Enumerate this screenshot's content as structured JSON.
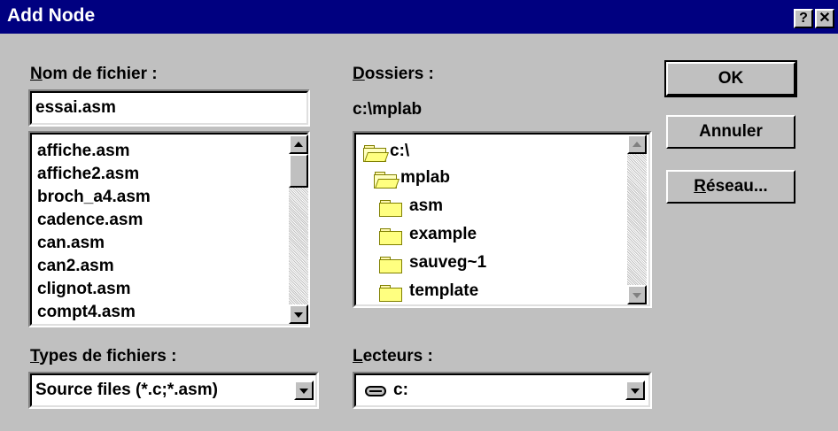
{
  "window": {
    "title": "Add Node",
    "help_btn": "?",
    "close_btn": "✕"
  },
  "filename": {
    "label_accel": "N",
    "label_rest": "om de fichier :",
    "value": "essai.asm",
    "files": [
      "affiche.asm",
      "affiche2.asm",
      "broch_a4.asm",
      "cadence.asm",
      "can.asm",
      "can2.asm",
      "clignot.asm",
      "compt4.asm"
    ]
  },
  "folders": {
    "label_accel": "D",
    "label_rest": "ossiers :",
    "current_path": "c:\\mplab",
    "tree": [
      {
        "name": "c:\\",
        "type": "open"
      },
      {
        "name": "mplab",
        "type": "open"
      },
      {
        "name": "asm",
        "type": "closed"
      },
      {
        "name": "example",
        "type": "closed"
      },
      {
        "name": "sauveg~1",
        "type": "closed"
      },
      {
        "name": "template",
        "type": "closed"
      }
    ]
  },
  "file_types": {
    "label_accel": "T",
    "label_rest": "ypes de fichiers :",
    "selected": "Source files (*.c;*.asm)"
  },
  "drives": {
    "label_accel": "L",
    "label_rest": "ecteurs :",
    "selected": "c:"
  },
  "buttons": {
    "ok": "OK",
    "cancel": "Annuler",
    "network_accel": "R",
    "network_rest": "éseau..."
  },
  "colors": {
    "titlebar": "#000080",
    "face": "#c0c0c0"
  }
}
